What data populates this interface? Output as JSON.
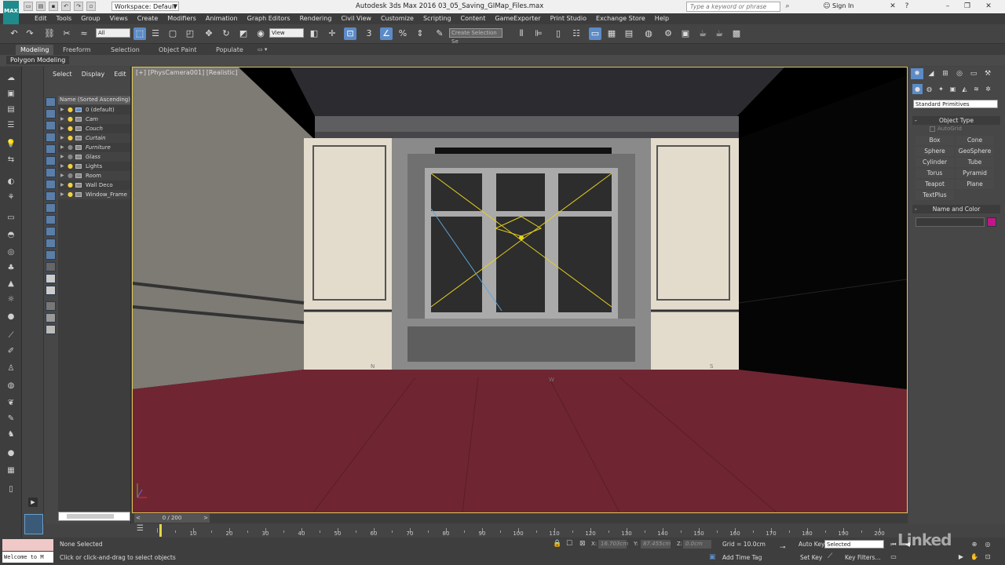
{
  "titlebar": {
    "logo": "MAX",
    "workspace": "Workspace: Default",
    "title": "Autodesk 3ds Max 2016    03_05_Saving_GIMap_Files.max",
    "search_placeholder": "Type a keyword or phrase",
    "sign_in": "Sign In"
  },
  "menu": [
    "Edit",
    "Tools",
    "Group",
    "Views",
    "Create",
    "Modifiers",
    "Animation",
    "Graph Editors",
    "Rendering",
    "Civil View",
    "Customize",
    "Scripting",
    "Content",
    "GameExporter",
    "Print Studio",
    "Exchange Store",
    "Help"
  ],
  "toolbar": {
    "selection_filter": "All",
    "ref_coord": "View",
    "named_selection": "Create Selection Se"
  },
  "ribbon": {
    "tabs": [
      "Modeling",
      "Freeform",
      "Selection",
      "Object Paint",
      "Populate"
    ],
    "panel_label": "Polygon Modeling"
  },
  "explorer": {
    "tabs": [
      "Select",
      "Display",
      "Edit"
    ],
    "column_header": "Name (Sorted Ascending)",
    "rows": [
      "0 (default)",
      "Cam",
      "Couch",
      "Curtain",
      "Furniture",
      "Glass",
      "Lights",
      "Room",
      "Wall Deco",
      "Window_Frame"
    ]
  },
  "viewport": {
    "label": "[+] [PhysCamera001] [Realistic]",
    "compass": [
      "N",
      "W",
      "S"
    ]
  },
  "command_panel": {
    "dropdown": "Standard Primitives",
    "object_type": "Object Type",
    "autogrid": "AutoGrid",
    "primitives": [
      "Box",
      "Cone",
      "Sphere",
      "GeoSphere",
      "Cylinder",
      "Tube",
      "Torus",
      "Pyramid",
      "Teapot",
      "Plane",
      "TextPlus"
    ],
    "name_and_color": "Name and Color",
    "color": "#c0168a"
  },
  "timeline": {
    "frame_display": "0 / 200",
    "ticks": [
      10,
      20,
      30,
      40,
      50,
      60,
      70,
      80,
      90,
      100,
      110,
      120,
      130,
      140,
      150,
      160,
      170,
      180,
      190,
      200
    ]
  },
  "status": {
    "maxscript": "Welcome to M",
    "selection": "None Selected",
    "hint": "Click or click-and-drag to select objects",
    "x_label": "X:",
    "x_value": "16.703cm",
    "y_label": "Y:",
    "y_value": "87.455cm",
    "z_label": "Z:",
    "z_value": "0.0cm",
    "grid": "Grid = 10.0cm",
    "add_time_tag": "Add Time Tag",
    "auto_key": "Auto Key",
    "set_key": "Set Key",
    "key_mode": "Selected",
    "key_filters": "Key Filters...",
    "watermark": "Linked"
  }
}
